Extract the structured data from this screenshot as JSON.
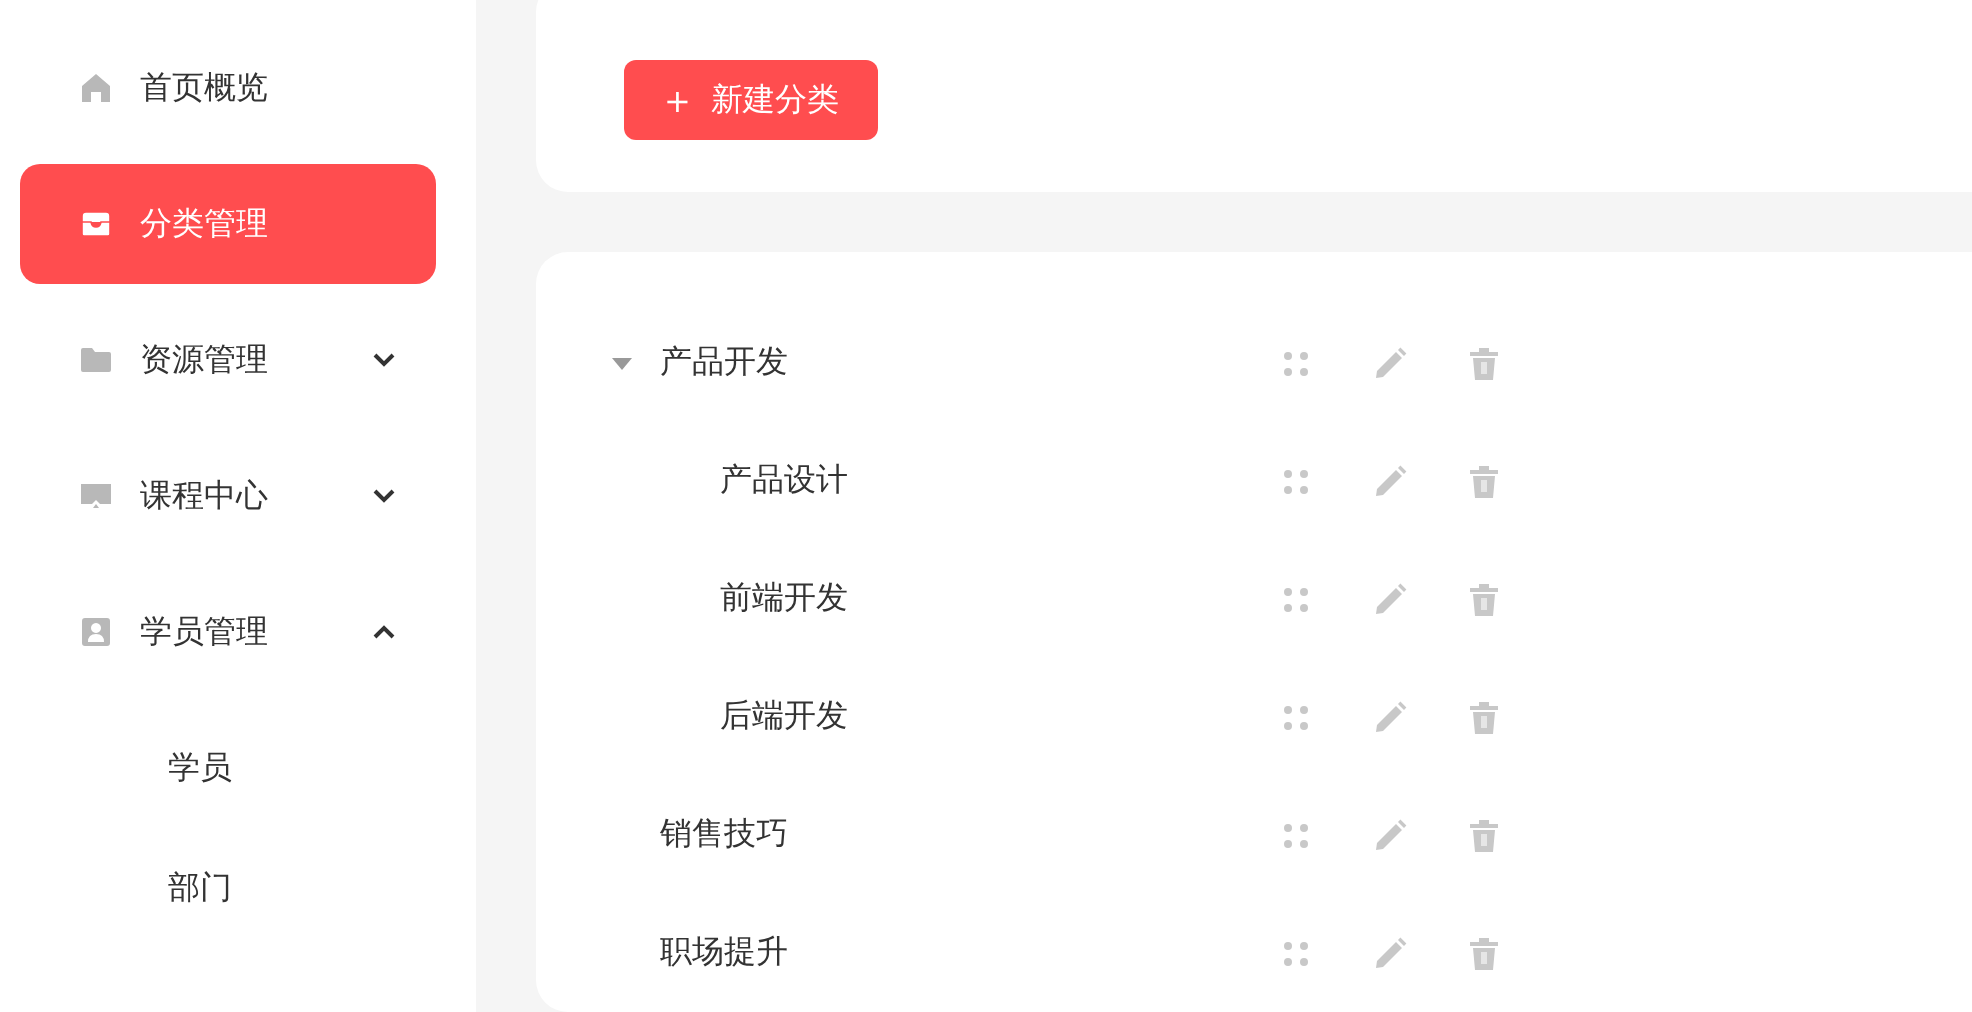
{
  "sidebar": {
    "items": [
      {
        "label": "首页概览",
        "selected": false
      },
      {
        "label": "分类管理",
        "selected": true
      },
      {
        "label": "资源管理",
        "selected": false,
        "expanded": false
      },
      {
        "label": "课程中心",
        "selected": false,
        "expanded": false
      },
      {
        "label": "学员管理",
        "selected": false,
        "expanded": true,
        "children": [
          {
            "label": "学员",
            "selected": false
          },
          {
            "label": "部门",
            "selected": false
          }
        ]
      }
    ]
  },
  "toolbar": {
    "new_button": {
      "icon": "+",
      "label": "新建分类"
    }
  },
  "tree": [
    {
      "label": "产品开发",
      "expanded": true,
      "children": [
        {
          "label": "产品设计"
        },
        {
          "label": "前端开发"
        },
        {
          "label": "后端开发"
        }
      ]
    },
    {
      "label": "销售技巧"
    },
    {
      "label": "职场提升"
    }
  ]
}
